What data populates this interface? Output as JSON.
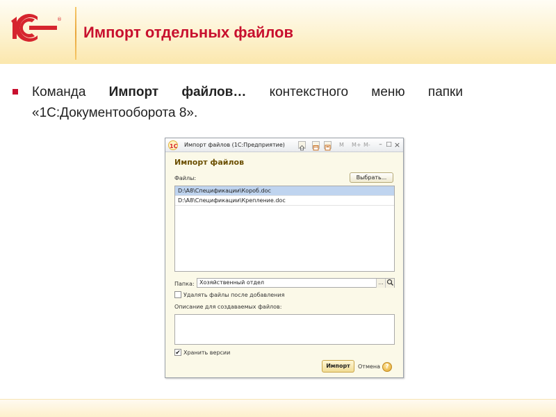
{
  "slide": {
    "title": "Импорт отдельных файлов",
    "bullet": {
      "prefix": "Команда ",
      "bold": "Импорт файлов…",
      "suffix": " контекстного меню папки «1С:Документооборота 8»."
    },
    "colors": {
      "title": "#c8102e",
      "accent": "#f0a030"
    }
  },
  "window": {
    "title": "Импорт файлов  (1С:Предприятие)",
    "toolbar_icons": [
      "home-icon",
      "calendar-icon",
      "calculator-icon"
    ],
    "memory_buttons": [
      "M",
      "M+",
      "M-"
    ],
    "window_buttons": {
      "minimize": "–",
      "maximize": "□",
      "close": "×"
    },
    "form_title": "Импорт файлов",
    "files_label": "Файлы:",
    "select_button": "Выбрать...",
    "files": [
      {
        "path": "D:\\A8\\Спецификации\\Короб.doc",
        "selected": true
      },
      {
        "path": "D:\\A8\\Спецификации\\Крепление.doc",
        "selected": false
      }
    ],
    "folder_label": "Папка:",
    "folder_value": "Хозяйственный отдел",
    "folder_select_button": "...",
    "delete_after_label": "Удалять файлы после добавления",
    "delete_after_checked": false,
    "description_label": "Описание для создаваемых файлов:",
    "description_value": "",
    "keep_versions_label": "Хранить версии",
    "keep_versions_checked": true,
    "import_button": "Импорт",
    "cancel_button": "Отмена",
    "help_glyph": "?"
  }
}
